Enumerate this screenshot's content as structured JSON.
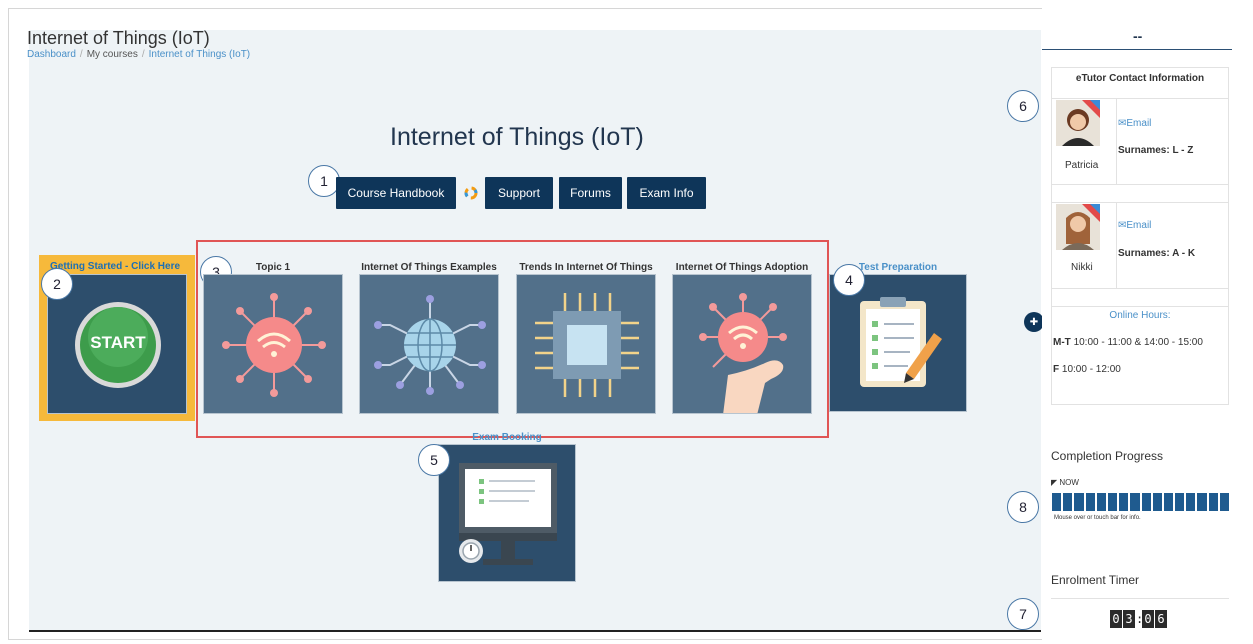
{
  "header": {
    "page_heading": "Internet of Things (IoT)",
    "breadcrumb": [
      "Dashboard",
      "My courses",
      "Internet of Things (IoT)"
    ]
  },
  "course": {
    "title": "Internet of Things (IoT)",
    "buttons": [
      "Course Handbook",
      "Support",
      "Forums",
      "Exam Info"
    ]
  },
  "tiles": {
    "getting_started": "Getting Started - Click Here",
    "start_label": "START",
    "topics": [
      "Topic 1",
      "Internet Of Things Examples",
      "Trends In Internet Of Things",
      "Internet Of Things Adoption"
    ],
    "test_preparation": "Test Preparation",
    "exam_booking": "Exam Booking"
  },
  "callouts": [
    "1",
    "2",
    "3",
    "4",
    "5",
    "6",
    "7",
    "8"
  ],
  "sidebar": {
    "header": "--",
    "contact_title": "eTutor Contact Information",
    "tutors": [
      {
        "name": "Patricia",
        "email": "Email",
        "surnames": "Surnames: L - Z"
      },
      {
        "name": "Nikki",
        "email": "Email",
        "surnames": "Surnames: A - K"
      }
    ],
    "online_hours_title": "Online Hours:",
    "hours": [
      {
        "days": "M-T",
        "times": "10:00 - 11:00 & 14:00 - 15:00"
      },
      {
        "days": "F",
        "times": "10:00 - 12:00"
      }
    ],
    "completion_title": "Completion Progress",
    "now_label": "NOW",
    "progress_segments": 16,
    "progress_hint": "Mouse over or touch bar for info.",
    "enrolment_title": "Enrolment Timer",
    "timer_digits": [
      "0",
      "3",
      "0",
      "6"
    ]
  },
  "colors": {
    "primary": "#0e3559",
    "tile_bg": "#2d4e6c",
    "accent_link": "#4a90c8",
    "highlight_box": "#e05555",
    "getting_started_bg": "#f6b93b"
  }
}
